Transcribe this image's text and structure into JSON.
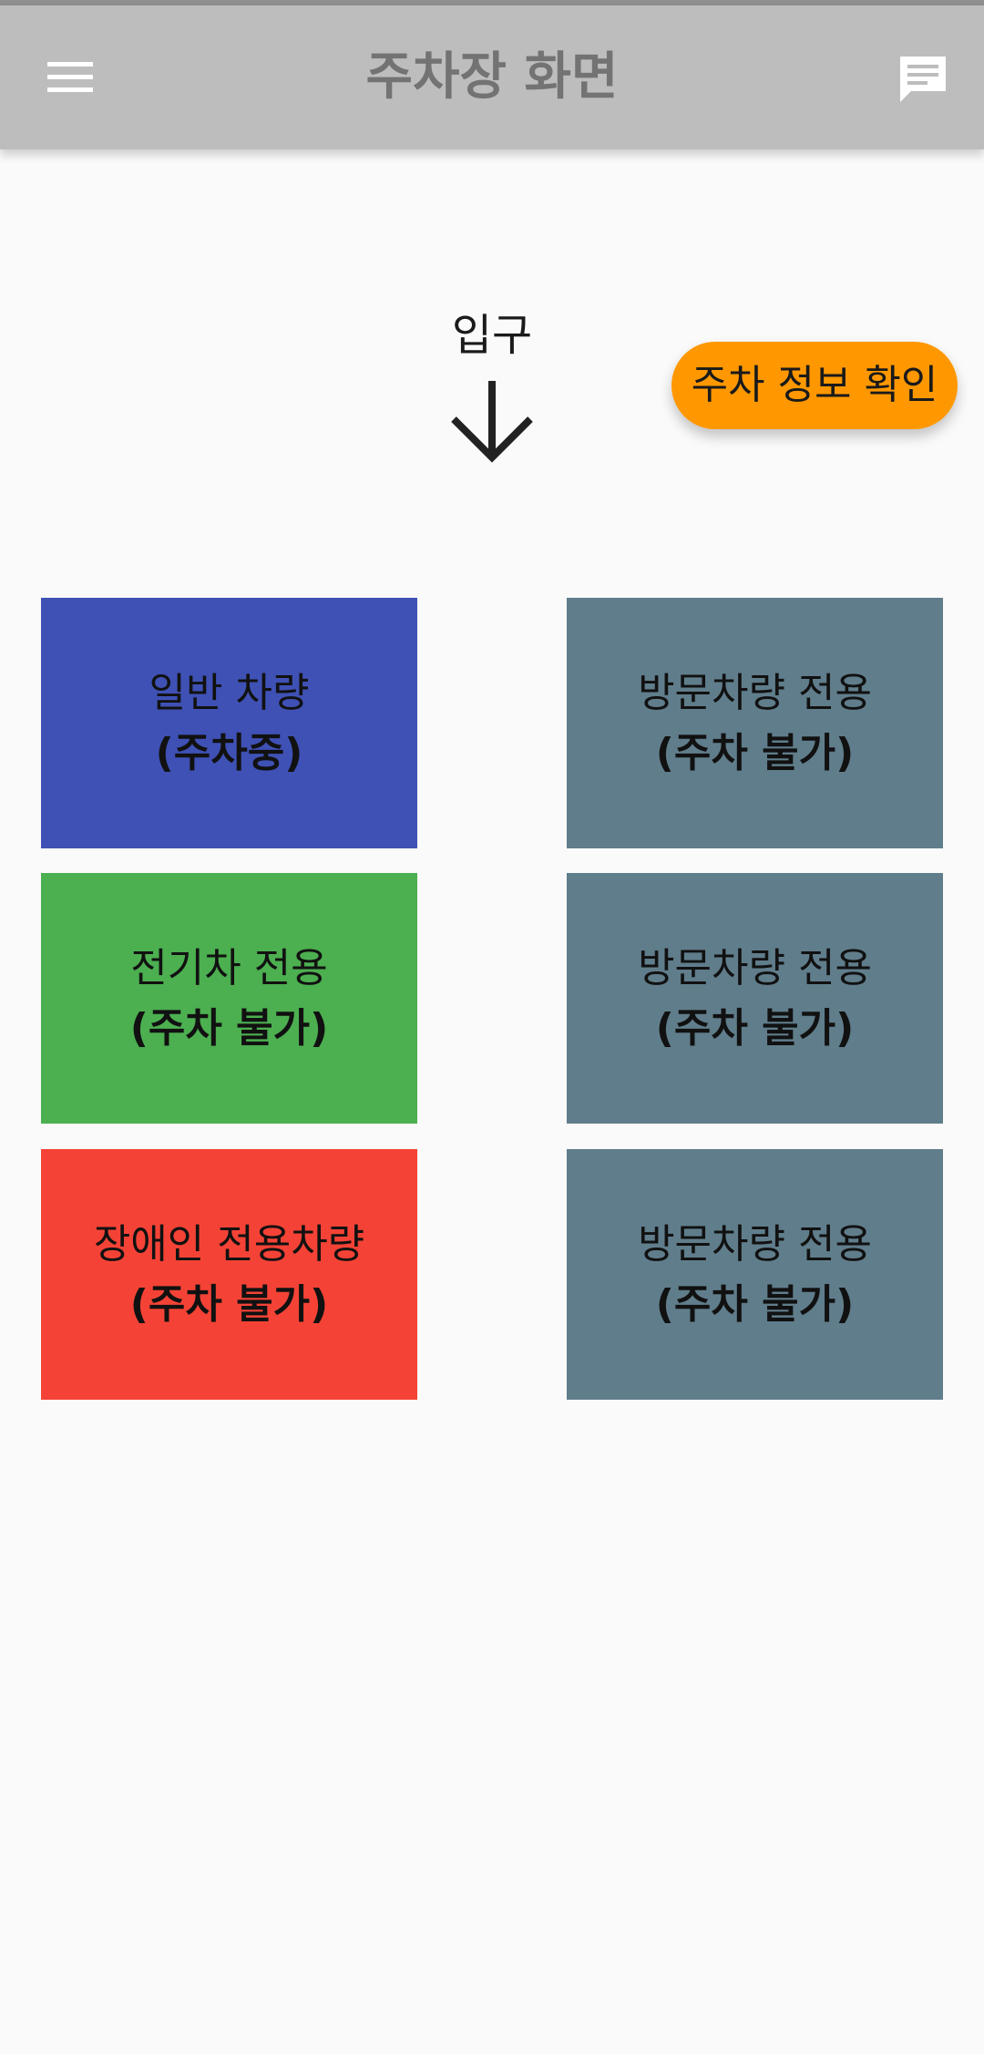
{
  "appbar": {
    "title": "주차장 화면",
    "menu_icon": "hamburger-menu-icon",
    "chat_icon": "chat-message-icon"
  },
  "entrance": {
    "label": "입구",
    "arrow_icon": "arrow-down-icon"
  },
  "info_button": {
    "label": "주차 정보 확인",
    "color": "#ff9800"
  },
  "slots": [
    {
      "type": "일반 차량",
      "status": "(주차중)",
      "color": "#3f51b5"
    },
    {
      "type": "방문차량 전용",
      "status": "(주차 불가)",
      "color": "#607d8b"
    },
    {
      "type": "전기차 전용",
      "status": "(주차 불가)",
      "color": "#4caf50"
    },
    {
      "type": "방문차량 전용",
      "status": "(주차 불가)",
      "color": "#607d8b"
    },
    {
      "type": "장애인 전용차량",
      "status": "(주차 불가)",
      "color": "#f44336"
    },
    {
      "type": "방문차량 전용",
      "status": "(주차 불가)",
      "color": "#607d8b"
    }
  ]
}
